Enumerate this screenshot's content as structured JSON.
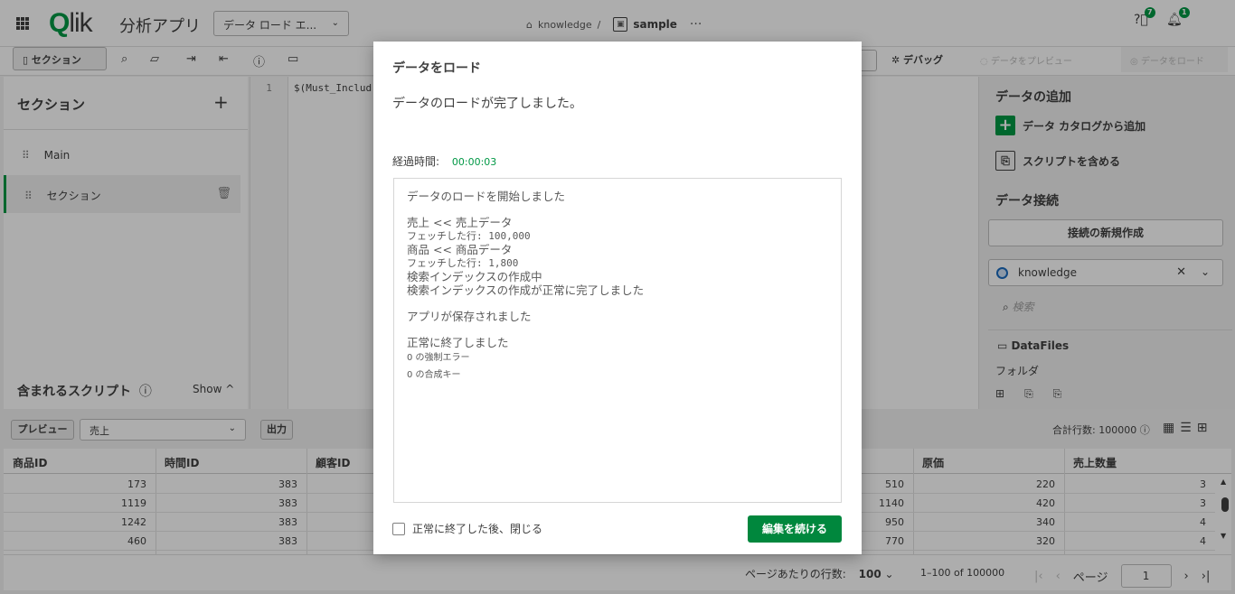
{
  "topbar": {
    "logo": "Qlik",
    "app_title": "分析アプリ",
    "section_dropdown": "データ ロード エ...",
    "space_name": "knowledge",
    "breadcrumb_sep": "/",
    "app_name": "sample",
    "more": "···",
    "help_badge": "7",
    "notif_badge": "1"
  },
  "toolbar": {
    "section_button": "セクション",
    "debug_label": "デバッグ",
    "preview_label": "データをプレビュー",
    "load_label": "データをロード"
  },
  "left_panel": {
    "title": "セクション",
    "sections": [
      {
        "label": "Main"
      },
      {
        "label": "セクション"
      }
    ],
    "included_scripts": "含まれるスクリプト",
    "show_label": "Show"
  },
  "editor": {
    "line_number": "1",
    "code": "$(Must_Includ"
  },
  "right_panel": {
    "add_data_title": "データの追加",
    "add_from_catalog": "データ カタログから追加",
    "include_script": "スクリプトを含める",
    "data_connections_title": "データ接続",
    "new_connection": "接続の新規作成",
    "connection_selected": "knowledge",
    "search_placeholder": "検索",
    "datafiles": "DataFiles",
    "folder": "フォルダ"
  },
  "preview": {
    "preview_button": "プレビュー",
    "table_selected": "売上",
    "output_button": "出力",
    "total_rows": "合計行数: 100000"
  },
  "table": {
    "headers": [
      "商品ID",
      "時間ID",
      "顧客ID",
      "原価",
      "売上数量"
    ],
    "rows": [
      {
        "c1": "173",
        "c2": "383",
        "c4": "510",
        "c5": "220",
        "c6": "3"
      },
      {
        "c1": "1119",
        "c2": "383",
        "c4": "1140",
        "c5": "420",
        "c6": "3"
      },
      {
        "c1": "1242",
        "c2": "383",
        "c4": "950",
        "c5": "340",
        "c6": "4"
      },
      {
        "c1": "460",
        "c2": "383",
        "c4": "770",
        "c5": "320",
        "c6": "4"
      }
    ]
  },
  "footer": {
    "rows_per_page_label": "ページあたりの行数:",
    "rows_per_page_value": "100",
    "range": "1–100 of 100000",
    "page_label": "ページ",
    "page_value": "1"
  },
  "modal": {
    "title": "データをロード",
    "message": "データのロードが完了しました。",
    "elapsed_label": "経過時間:",
    "elapsed_value": "00:00:03",
    "log": {
      "started": "データのロードを開始しました",
      "line1": "売上 << 売上データ",
      "line2": "フェッチした行: 100,000",
      "line3": "商品 << 商品データ",
      "line4": "フェッチした行: 1,800",
      "line5": "検索インデックスの作成中",
      "line6": "検索インデックスの作成が正常に完了しました",
      "saved": "アプリが保存されました",
      "finished": "正常に終了しました",
      "errors": "0 の強制エラー",
      "synkeys": "0 の合成キー"
    },
    "close_checkbox_label": "正常に終了した後、閉じる",
    "continue_button": "編集を続ける"
  }
}
